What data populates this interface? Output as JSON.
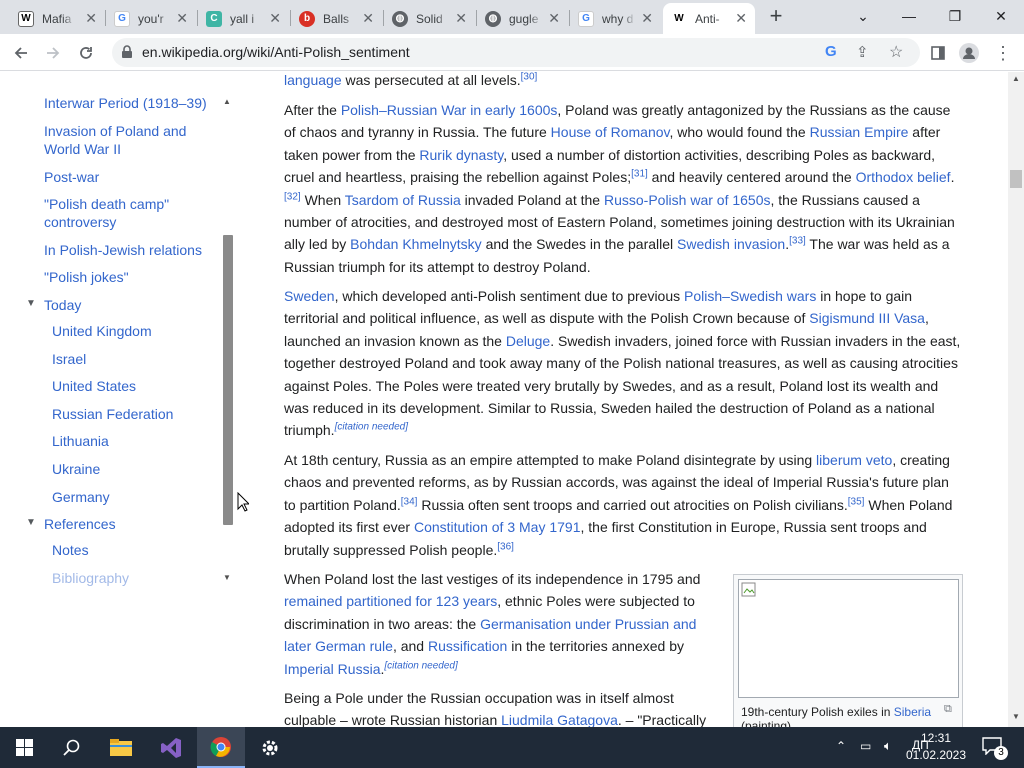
{
  "tabs": [
    {
      "label": "Mafia",
      "icon": "wikipedia-icon",
      "active": false
    },
    {
      "label": "you'r",
      "icon": "google-icon",
      "active": false
    },
    {
      "label": "yall i",
      "icon": "crypto-icon",
      "active": false
    },
    {
      "label": "Balls",
      "icon": "bing-icon",
      "active": false
    },
    {
      "label": "Solid",
      "icon": "globe-icon",
      "active": false
    },
    {
      "label": "gugle",
      "icon": "globe-icon",
      "active": false
    },
    {
      "label": "why d",
      "icon": "google-icon",
      "active": false
    },
    {
      "label": "Anti-",
      "icon": "wikipedia-icon",
      "active": true
    }
  ],
  "window_controls": {
    "minimize": "—",
    "restore": "❐",
    "close": "✕",
    "tab_search": "⌄",
    "new_tab": "+"
  },
  "toolbar": {
    "url": "en.wikipedia.org/wiki/Anti-Polish_sentiment"
  },
  "toc": {
    "items": [
      "Interwar Period (1918–39)",
      "Invasion of Poland and World War II",
      "Post-war",
      "\"Polish death camp\" controversy",
      "In Polish-Jewish relations",
      "\"Polish jokes\""
    ],
    "today": {
      "label": "Today",
      "children": [
        "United Kingdom",
        "Israel",
        "United States",
        "Russian Federation",
        "Lithuania",
        "Ukraine",
        "Germany"
      ]
    },
    "references": {
      "label": "References",
      "children": [
        "Notes",
        "Bibliography"
      ]
    }
  },
  "article": {
    "p0": {
      "link": "language",
      "text": " was persecuted at all levels.",
      "ref": "[30]"
    },
    "figure_caption": {
      "text": "19th-century Polish exiles in ",
      "link": "Siberia",
      "tail": "(painting)"
    }
  },
  "taskbar": {
    "time": "12:31",
    "date": "01.02.2023",
    "notifications": "3"
  }
}
